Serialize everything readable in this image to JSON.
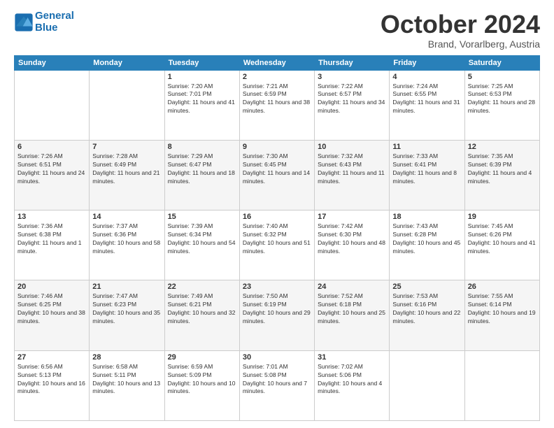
{
  "logo": {
    "line1": "General",
    "line2": "Blue"
  },
  "title": "October 2024",
  "location": "Brand, Vorarlberg, Austria",
  "headers": [
    "Sunday",
    "Monday",
    "Tuesday",
    "Wednesday",
    "Thursday",
    "Friday",
    "Saturday"
  ],
  "weeks": [
    [
      {
        "day": "",
        "info": ""
      },
      {
        "day": "",
        "info": ""
      },
      {
        "day": "1",
        "info": "Sunrise: 7:20 AM\nSunset: 7:01 PM\nDaylight: 11 hours and 41 minutes."
      },
      {
        "day": "2",
        "info": "Sunrise: 7:21 AM\nSunset: 6:59 PM\nDaylight: 11 hours and 38 minutes."
      },
      {
        "day": "3",
        "info": "Sunrise: 7:22 AM\nSunset: 6:57 PM\nDaylight: 11 hours and 34 minutes."
      },
      {
        "day": "4",
        "info": "Sunrise: 7:24 AM\nSunset: 6:55 PM\nDaylight: 11 hours and 31 minutes."
      },
      {
        "day": "5",
        "info": "Sunrise: 7:25 AM\nSunset: 6:53 PM\nDaylight: 11 hours and 28 minutes."
      }
    ],
    [
      {
        "day": "6",
        "info": "Sunrise: 7:26 AM\nSunset: 6:51 PM\nDaylight: 11 hours and 24 minutes."
      },
      {
        "day": "7",
        "info": "Sunrise: 7:28 AM\nSunset: 6:49 PM\nDaylight: 11 hours and 21 minutes."
      },
      {
        "day": "8",
        "info": "Sunrise: 7:29 AM\nSunset: 6:47 PM\nDaylight: 11 hours and 18 minutes."
      },
      {
        "day": "9",
        "info": "Sunrise: 7:30 AM\nSunset: 6:45 PM\nDaylight: 11 hours and 14 minutes."
      },
      {
        "day": "10",
        "info": "Sunrise: 7:32 AM\nSunset: 6:43 PM\nDaylight: 11 hours and 11 minutes."
      },
      {
        "day": "11",
        "info": "Sunrise: 7:33 AM\nSunset: 6:41 PM\nDaylight: 11 hours and 8 minutes."
      },
      {
        "day": "12",
        "info": "Sunrise: 7:35 AM\nSunset: 6:39 PM\nDaylight: 11 hours and 4 minutes."
      }
    ],
    [
      {
        "day": "13",
        "info": "Sunrise: 7:36 AM\nSunset: 6:38 PM\nDaylight: 11 hours and 1 minute."
      },
      {
        "day": "14",
        "info": "Sunrise: 7:37 AM\nSunset: 6:36 PM\nDaylight: 10 hours and 58 minutes."
      },
      {
        "day": "15",
        "info": "Sunrise: 7:39 AM\nSunset: 6:34 PM\nDaylight: 10 hours and 54 minutes."
      },
      {
        "day": "16",
        "info": "Sunrise: 7:40 AM\nSunset: 6:32 PM\nDaylight: 10 hours and 51 minutes."
      },
      {
        "day": "17",
        "info": "Sunrise: 7:42 AM\nSunset: 6:30 PM\nDaylight: 10 hours and 48 minutes."
      },
      {
        "day": "18",
        "info": "Sunrise: 7:43 AM\nSunset: 6:28 PM\nDaylight: 10 hours and 45 minutes."
      },
      {
        "day": "19",
        "info": "Sunrise: 7:45 AM\nSunset: 6:26 PM\nDaylight: 10 hours and 41 minutes."
      }
    ],
    [
      {
        "day": "20",
        "info": "Sunrise: 7:46 AM\nSunset: 6:25 PM\nDaylight: 10 hours and 38 minutes."
      },
      {
        "day": "21",
        "info": "Sunrise: 7:47 AM\nSunset: 6:23 PM\nDaylight: 10 hours and 35 minutes."
      },
      {
        "day": "22",
        "info": "Sunrise: 7:49 AM\nSunset: 6:21 PM\nDaylight: 10 hours and 32 minutes."
      },
      {
        "day": "23",
        "info": "Sunrise: 7:50 AM\nSunset: 6:19 PM\nDaylight: 10 hours and 29 minutes."
      },
      {
        "day": "24",
        "info": "Sunrise: 7:52 AM\nSunset: 6:18 PM\nDaylight: 10 hours and 25 minutes."
      },
      {
        "day": "25",
        "info": "Sunrise: 7:53 AM\nSunset: 6:16 PM\nDaylight: 10 hours and 22 minutes."
      },
      {
        "day": "26",
        "info": "Sunrise: 7:55 AM\nSunset: 6:14 PM\nDaylight: 10 hours and 19 minutes."
      }
    ],
    [
      {
        "day": "27",
        "info": "Sunrise: 6:56 AM\nSunset: 5:13 PM\nDaylight: 10 hours and 16 minutes."
      },
      {
        "day": "28",
        "info": "Sunrise: 6:58 AM\nSunset: 5:11 PM\nDaylight: 10 hours and 13 minutes."
      },
      {
        "day": "29",
        "info": "Sunrise: 6:59 AM\nSunset: 5:09 PM\nDaylight: 10 hours and 10 minutes."
      },
      {
        "day": "30",
        "info": "Sunrise: 7:01 AM\nSunset: 5:08 PM\nDaylight: 10 hours and 7 minutes."
      },
      {
        "day": "31",
        "info": "Sunrise: 7:02 AM\nSunset: 5:06 PM\nDaylight: 10 hours and 4 minutes."
      },
      {
        "day": "",
        "info": ""
      },
      {
        "day": "",
        "info": ""
      }
    ]
  ]
}
